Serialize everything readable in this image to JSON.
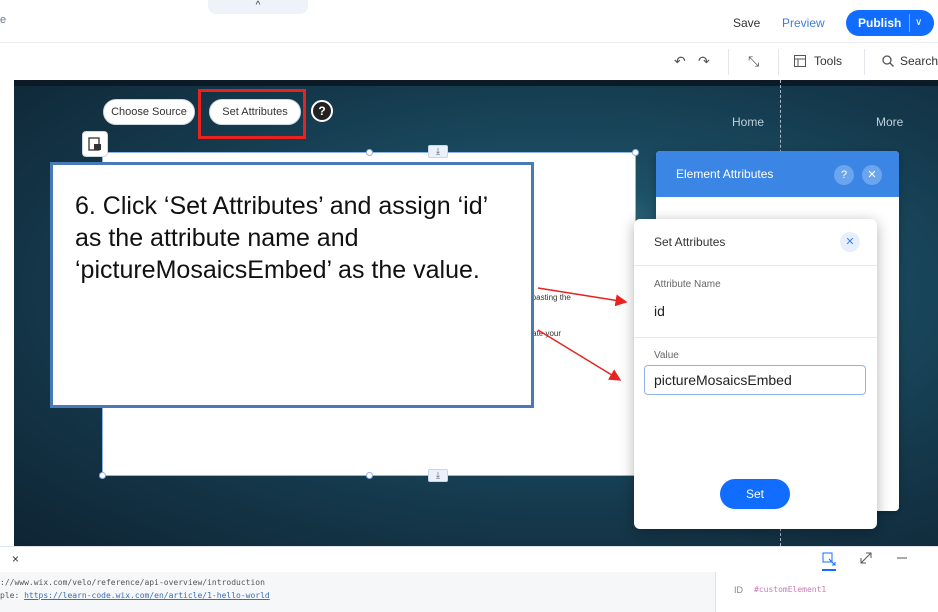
{
  "topbar": {
    "edge_letter": "e",
    "handle_glyph": "^",
    "save": "Save",
    "preview": "Preview",
    "publish": "Publish",
    "publish_chevron": "∨"
  },
  "toolbar": {
    "undo_glyph": "↶",
    "redo_glyph": "↷",
    "zoom_glyph": "⤡",
    "tools": "Tools",
    "search": "Search"
  },
  "canvas": {
    "nav": {
      "home": "Home",
      "more": "More"
    },
    "buttons": {
      "choose_source": "Choose Source",
      "set_attributes": "Set Attributes",
      "help": "?"
    },
    "element_hints": {
      "line1": "d pasting the",
      "line2": "reate your"
    },
    "anchor_glyph": "⤓"
  },
  "callout": {
    "text": "6. Click ‘Set Attributes’ and assign ‘id’ as the attribute name and ‘pictureMosaicsEmbed’ as the value."
  },
  "element_attributes_panel": {
    "title": "Element Attributes",
    "help": "?",
    "close": "✕"
  },
  "set_attributes_popup": {
    "title": "Set Attributes",
    "close": "✕",
    "attribute_name_label": "Attribute Name",
    "attribute_name_value": "id",
    "value_label": "Value",
    "value_value": "pictureMosaicsEmbed",
    "set_button": "Set"
  },
  "bottom": {
    "close": "×",
    "code_line1": "://www.wix.com/velo/reference/api-overview/introduction",
    "code_line2_prefix": "ple: ",
    "code_line2_url": "https://learn-code.wix.com/en/article/1-hello-world",
    "id_label": "ID",
    "id_value": "#customElement1"
  },
  "colors": {
    "accent": "#116dff",
    "panel_header": "#3b86e4",
    "highlight": "#e8231f",
    "callout_border": "#4a79b8"
  },
  "icons": [
    "undo-icon",
    "redo-icon",
    "zoom-icon",
    "tools-icon",
    "search-icon",
    "help-icon",
    "close-icon",
    "element-type-icon",
    "anchor-icon",
    "layers-icon",
    "expand-icon",
    "minimize-icon"
  ]
}
